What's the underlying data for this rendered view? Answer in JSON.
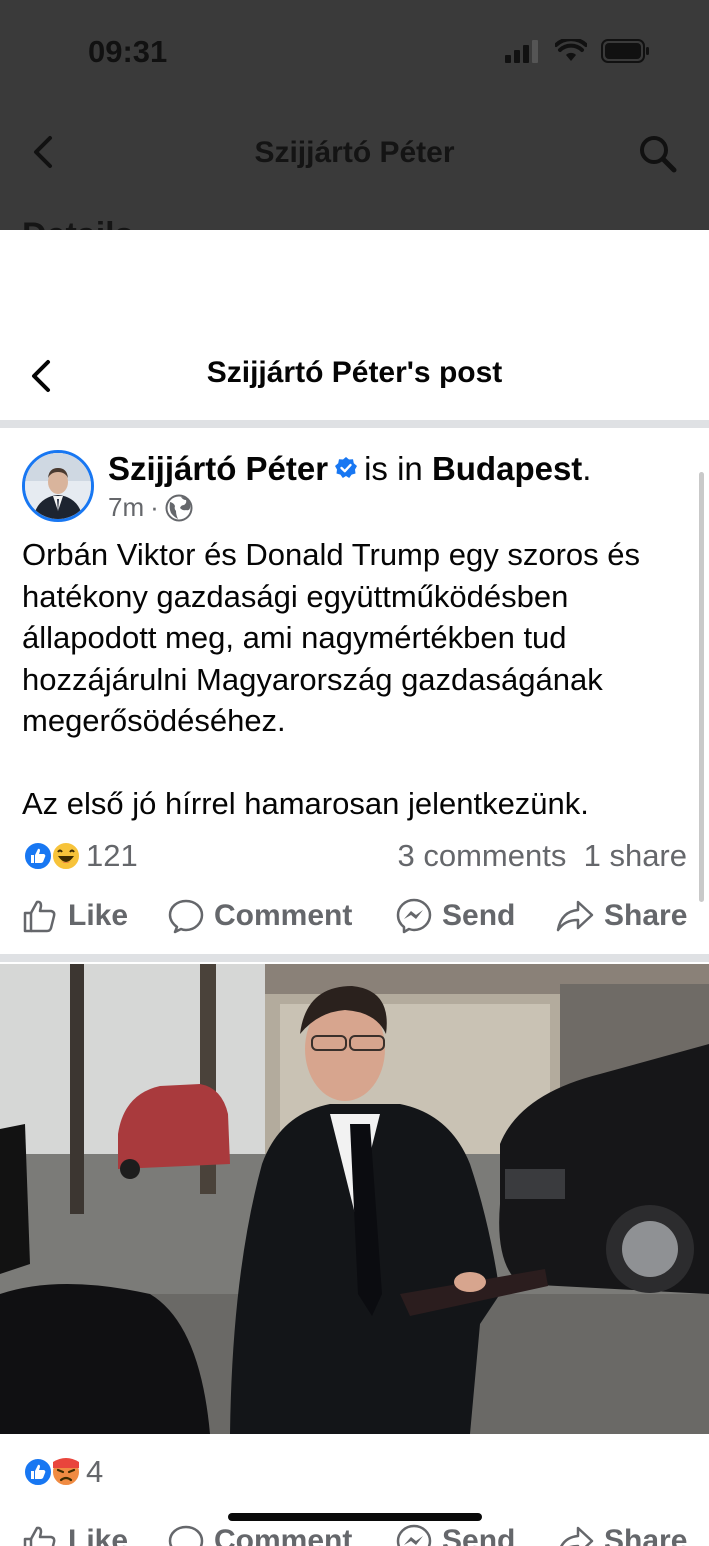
{
  "status_bar": {
    "time": "09:31"
  },
  "background_page": {
    "title": "Szijjártó Péter",
    "peek_text": "Details"
  },
  "sheet": {
    "title": "Szijjártó Péter's post"
  },
  "post": {
    "author": "Szijjártó Péter",
    "location_prefix": "is in",
    "location": "Budapest",
    "location_suffix": ".",
    "time": "7m",
    "separator": "·",
    "text_paragraph_1": "Orbán Viktor és Donald Trump egy szoros és hatékony gazdasági együttműködésben állapodott meg, ami nagymértékben tud hozzájárulni Magyarország gazdaságának megerősödéséhez.",
    "text_paragraph_2": "Az első jó hírrel hamarosan jelentkezünk.",
    "reaction_count": "121",
    "comments": "3 comments",
    "shares": "1 share",
    "actions": {
      "like": "Like",
      "comment": "Comment",
      "send": "Send",
      "share": "Share"
    }
  },
  "photo": {
    "reaction_count": "4",
    "actions": {
      "like": "Like",
      "comment": "Comment",
      "send": "Send",
      "share": "Share"
    }
  },
  "colors": {
    "accent": "#1877f2",
    "text": "#050505",
    "secondary_text": "#65676b",
    "overlay": "#3a3a3a",
    "divider": "#dfe1e4"
  }
}
